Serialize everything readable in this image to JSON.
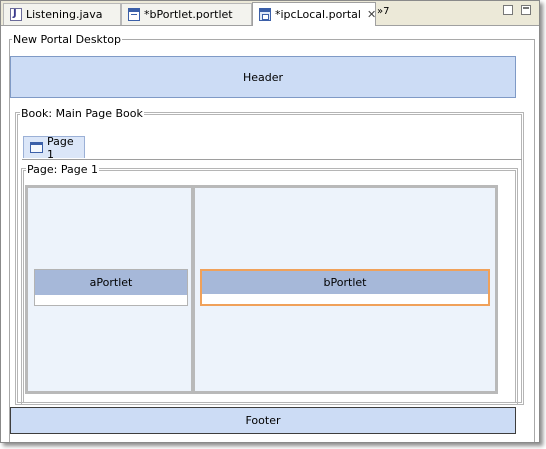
{
  "tabs": [
    {
      "label": "Listening.java",
      "icon": "java-file-icon",
      "active": false
    },
    {
      "label": "*bPortlet.portlet",
      "icon": "portlet-file-icon",
      "active": false
    },
    {
      "label": "*ipcLocal.portal",
      "icon": "portal-file-icon",
      "active": true
    }
  ],
  "tab_overflow": "»7",
  "desktop": {
    "legend": "New Portal Desktop",
    "header_label": "Header",
    "footer_label": "Footer",
    "book": {
      "legend": "Book: Main Page Book",
      "page_tab_label": "Page 1",
      "page": {
        "legend": "Page: Page 1",
        "portlets": [
          {
            "label": "aPortlet",
            "selected": false
          },
          {
            "label": "bPortlet",
            "selected": true
          }
        ]
      }
    }
  },
  "colors": {
    "selection": "#f0a15a",
    "portlet_title": "#a6b8d9",
    "header_fill": "#ccdcf5",
    "column_fill": "#edf3fb"
  }
}
